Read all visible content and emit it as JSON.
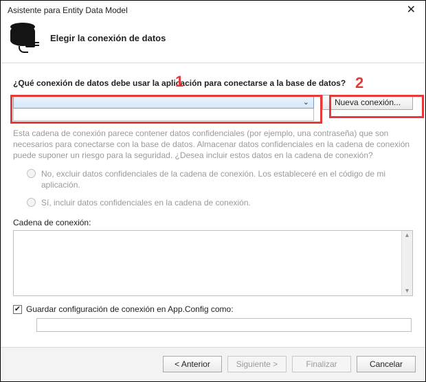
{
  "window": {
    "title": "Asistente para Entity Data Model"
  },
  "header": {
    "title": "Elegir la conexión de datos"
  },
  "callouts": {
    "one": "1",
    "two": "2"
  },
  "main": {
    "question": "¿Qué conexión de datos debe usar la aplicación para conectarse a la base de datos?",
    "new_connection_label": "Nueva conexión...",
    "disabled_paragraph": "Esta cadena de conexión parece contener datos confidenciales (por ejemplo, una contraseña) que son necesarios para conectarse con la base de datos. Almacenar datos confidenciales en la cadena de conexión puede suponer un riesgo para la seguridad. ¿Desea incluir estos datos en la cadena de conexión?",
    "radio_exclude_label": "No, excluir datos confidenciales de la cadena de conexión. Los estableceré en el código de mi aplicación.",
    "radio_include_label": "Sí, incluir datos confidenciales en la cadena de conexión.",
    "conn_string_label": "Cadena de conexión:",
    "save_config_label": "Guardar configuración de conexión en App.Config como:",
    "save_config_checked": true,
    "config_name_value": ""
  },
  "buttons": {
    "back": "< Anterior",
    "next": "Siguiente >",
    "finish": "Finalizar",
    "cancel": "Cancelar"
  }
}
